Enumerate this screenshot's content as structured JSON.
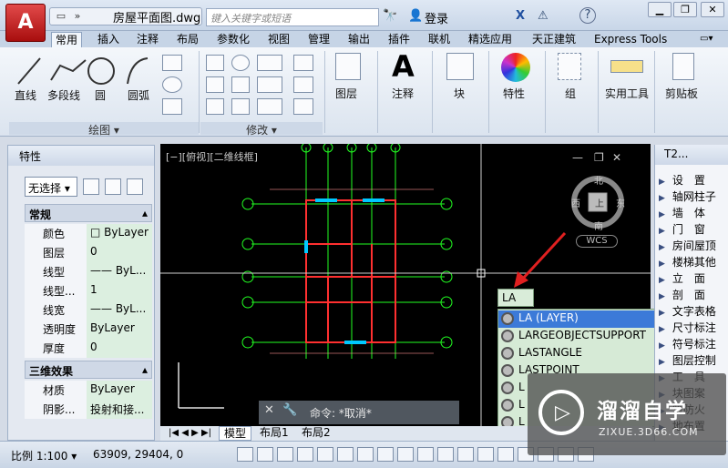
{
  "app": {
    "logo_letter": "A",
    "doc_title": "房屋平面图.dwg",
    "search_placeholder": "键入关键字或短语",
    "login": "登录"
  },
  "tabs": [
    "常用",
    "插入",
    "注释",
    "布局",
    "参数化",
    "视图",
    "管理",
    "输出",
    "插件",
    "联机",
    "精选应用",
    "天正建筑",
    "Express Tools"
  ],
  "ribbon": {
    "draw_labels": [
      "直线",
      "多段线",
      "圆",
      "圆弧"
    ],
    "big_labels": [
      "图层",
      "注释",
      "块",
      "特性",
      "组",
      "实用工具",
      "剪贴板"
    ],
    "groups": [
      "绘图",
      "修改"
    ]
  },
  "props": {
    "title": "特性",
    "selection": "无选择",
    "section_general": "常规",
    "rows_general": [
      {
        "k": "颜色",
        "v": "□ ByLayer"
      },
      {
        "k": "图层",
        "v": "0"
      },
      {
        "k": "线型",
        "v": "—— ByL..."
      },
      {
        "k": "线型...",
        "v": "1"
      },
      {
        "k": "线宽",
        "v": "—— ByL..."
      },
      {
        "k": "透明度",
        "v": "ByLayer"
      },
      {
        "k": "厚度",
        "v": "0"
      }
    ],
    "section_3d": "三维效果",
    "rows_3d": [
      {
        "k": "材质",
        "v": "ByLayer"
      },
      {
        "k": "阴影...",
        "v": "投射和接..."
      }
    ]
  },
  "viewport_label": "[−][俯视][二维线框]",
  "viewcube": {
    "north": "北",
    "south": "南",
    "east": "东",
    "west": "西",
    "top": "上",
    "wcs": "WCS"
  },
  "command": {
    "prompt": "命令: *取消*",
    "typed": "LA"
  },
  "autocomplete": [
    "LA (LAYER)",
    "LARGEOBJECTSUPPORT",
    "LASTANGLE",
    "LASTPOINT",
    "L",
    "L",
    "L"
  ],
  "tpalette": {
    "title": "T2...",
    "items": [
      "设　置",
      "轴网柱子",
      "墙　体",
      "门　窗",
      "房间屋顶",
      "楼梯其他",
      "立　面",
      "剖　面",
      "文字表格",
      "尺寸标注",
      "符号标注",
      "图层控制",
      "工　具",
      "块图案",
      "筑防火",
      "地布置"
    ]
  },
  "layout_tabs": [
    "模型",
    "布局1",
    "布局2"
  ],
  "status": {
    "scale": "比例 1:100",
    "coords": "63909, 29404, 0"
  },
  "watermark": {
    "title": "溜溜自学",
    "sub": "ZIXUE.3D66.COM"
  },
  "colors": {
    "accent": "#3c7ad8",
    "canvas": "#000000",
    "wall": "#ff3030",
    "axis": "#22ff22",
    "window": "#00c8ff"
  }
}
